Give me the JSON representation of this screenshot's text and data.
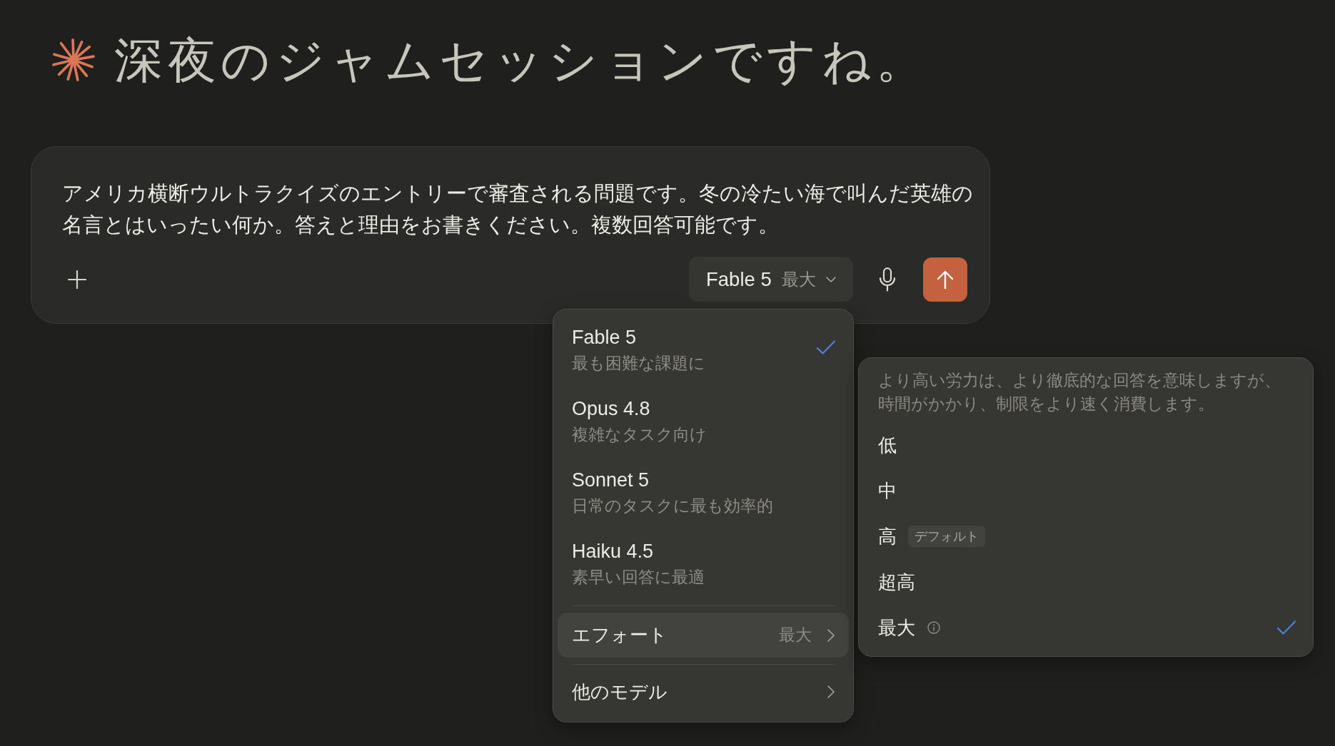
{
  "greeting": {
    "text": "深夜のジャムセッションですね。"
  },
  "composer": {
    "message": {
      "value": "アメリカ横断ウルトラクイズのエントリーで審査される問題です。冬の冷たい海で叫んだ英雄の名言とはいったい何か。答えと理由をお書きください。複数回答可能です。"
    },
    "model_selector": {
      "model": "Fable 5",
      "effort": "最大"
    }
  },
  "model_menu": {
    "models": [
      {
        "name": "Fable 5",
        "description": "最も困難な課題に",
        "selected": true
      },
      {
        "name": "Opus 4.8",
        "description": "複雑なタスク向け",
        "selected": false
      },
      {
        "name": "Sonnet 5",
        "description": "日常のタスクに最も効率的",
        "selected": false
      },
      {
        "name": "Haiku 4.5",
        "description": "素早い回答に最適",
        "selected": false
      }
    ],
    "effort_row": {
      "label": "エフォート",
      "value": "最大",
      "expanded": true
    },
    "other_models": {
      "label": "他のモデル"
    }
  },
  "effort_menu": {
    "description": "より高い労力は、より徹底的な回答を意味しますが、時間がかかり、制限をより速く消費します。",
    "options": [
      {
        "label": "低",
        "info": false,
        "selected": false
      },
      {
        "label": "中",
        "info": false,
        "selected": false
      },
      {
        "label": "高",
        "badge": "デフォルト",
        "info": false,
        "selected": false
      },
      {
        "label": "超高",
        "info": false,
        "selected": false
      },
      {
        "label": "最大",
        "info": true,
        "selected": true
      }
    ]
  }
}
